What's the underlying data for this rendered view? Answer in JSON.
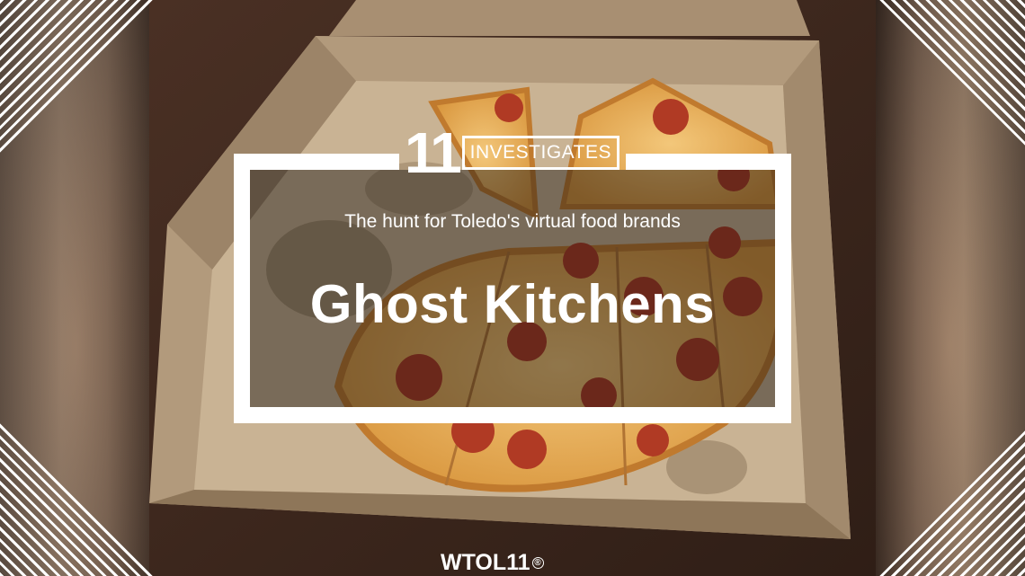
{
  "brand": {
    "logo_number": "11",
    "logo_word": "INVESTIGATES",
    "watermark": "WTOL11",
    "watermark_mark": "®"
  },
  "card": {
    "subtitle": "The hunt for Toledo's virtual food brands",
    "headline": "Ghost Kitchens"
  },
  "colors": {
    "frame": "#ffffff",
    "text": "#ffffff",
    "overlay": "rgba(25,20,18,0.45)"
  },
  "scene": {
    "subject": "pizza-box-photo"
  }
}
